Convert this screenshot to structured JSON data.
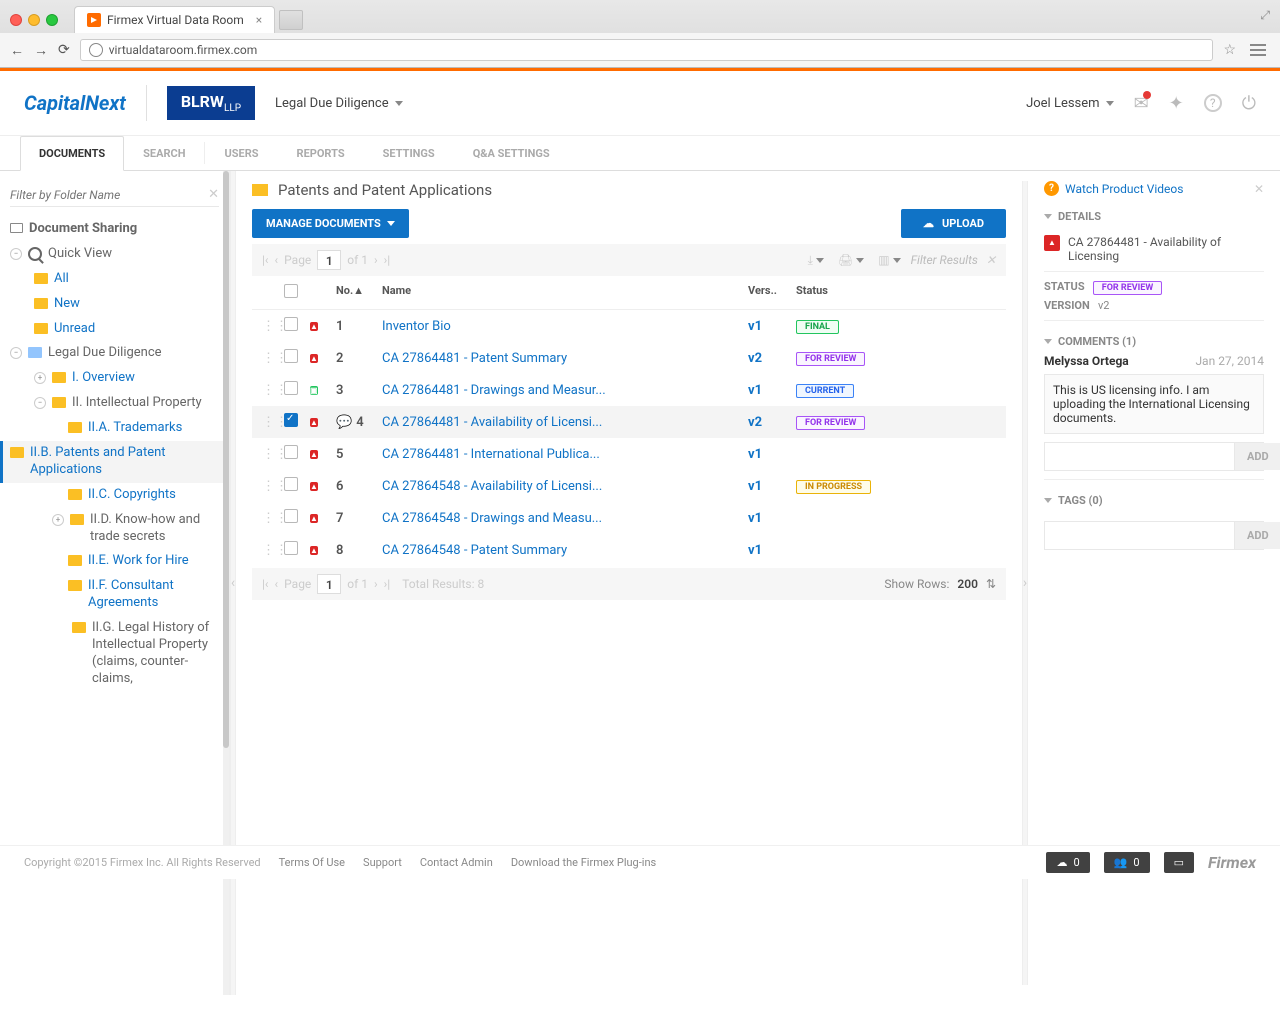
{
  "browser": {
    "tab_title": "Firmex Virtual Data Room",
    "url": "virtualdataroom.firmex.com"
  },
  "header": {
    "logo1": "CapitalNext",
    "logo2_main": "BLRW",
    "logo2_sub": "LLP",
    "project": "Legal Due Diligence",
    "user": "Joel Lessem"
  },
  "tabs": [
    "DOCUMENTS",
    "SEARCH",
    "USERS",
    "REPORTS",
    "SETTINGS",
    "Q&A SETTINGS"
  ],
  "sidebar": {
    "filter_placeholder": "Filter by Folder Name",
    "root1": "Document Sharing",
    "root2": "Quick View",
    "qv": [
      "All",
      "New",
      "Unread"
    ],
    "root3": "Legal Due Diligence",
    "items": [
      {
        "label": "I. Overview"
      },
      {
        "label": "II. Intellectual Property"
      },
      {
        "label": "II.A. Trademarks"
      },
      {
        "label": "II.B. Patents and Patent Applications"
      },
      {
        "label": "II.C. Copyrights"
      },
      {
        "label": "II.D. Know-how and trade secrets"
      },
      {
        "label": "II.E. Work for Hire"
      },
      {
        "label": "II.F. Consultant Agreements"
      },
      {
        "label": "II.G. Legal History of Intellectual Property (claims, counter-claims,"
      }
    ]
  },
  "main": {
    "breadcrumb": "Patents and Patent Applications",
    "manage_btn": "MANAGE DOCUMENTS",
    "upload_btn": "UPLOAD",
    "page_label": "Page",
    "page_num": "1",
    "page_of": "of 1",
    "filter_placeholder": "Filter Results",
    "cols": {
      "no": "No.",
      "name": "Name",
      "vers": "Vers..",
      "status": "Status"
    },
    "rows": [
      {
        "no": "1",
        "name": "Inventor Bio",
        "vers": "v1",
        "status": "FINAL",
        "icon": "pdf"
      },
      {
        "no": "2",
        "name": "CA 27864481 - Patent Summary",
        "vers": "v2",
        "status": "FOR REVIEW",
        "icon": "pdf"
      },
      {
        "no": "3",
        "name": "CA 27864481 - Drawings and Measur...",
        "vers": "v1",
        "status": "CURRENT",
        "icon": "px"
      },
      {
        "no": "4",
        "name": "CA 27864481 - Availability of Licensi...",
        "vers": "v2",
        "status": "FOR REVIEW",
        "icon": "pdf",
        "selected": true,
        "comment": true
      },
      {
        "no": "5",
        "name": "CA 27864481 - International Publica...",
        "vers": "v1",
        "status": "",
        "icon": "pdf"
      },
      {
        "no": "6",
        "name": "CA 27864548 - Availability of Licensi...",
        "vers": "v1",
        "status": "IN PROGRESS",
        "icon": "pdf"
      },
      {
        "no": "7",
        "name": "CA 27864548 - Drawings and Measu...",
        "vers": "v1",
        "status": "",
        "icon": "pdf"
      },
      {
        "no": "8",
        "name": "CA 27864548 - Patent Summary",
        "vers": "v1",
        "status": "",
        "icon": "pdf"
      }
    ],
    "total_results": "Total Results: 8",
    "show_rows_label": "Show Rows:",
    "show_rows_val": "200"
  },
  "details": {
    "watch": "Watch Product Videos",
    "details_hdr": "DETAILS",
    "doc_title": "CA 27864481 - Availability of Licensing",
    "status_label": "STATUS",
    "status_val": "FOR REVIEW",
    "version_label": "VERSION",
    "version_val": "v2",
    "comments_hdr": "COMMENTS (1)",
    "comment_author": "Melyssa Ortega",
    "comment_date": "Jan 27, 2014",
    "comment_text": "This is US licensing info. I am uploading the International Licensing documents.",
    "add_btn": "ADD",
    "tags_hdr": "TAGS (0)"
  },
  "footer": {
    "copyright": "Copyright ©2015 Firmex Inc. All Rights Reserved",
    "links": [
      "Terms Of Use",
      "Support",
      "Contact Admin",
      "Download the Firmex Plug-ins"
    ],
    "upload_count": "0",
    "users_count": "0",
    "brand": "Firmex"
  }
}
